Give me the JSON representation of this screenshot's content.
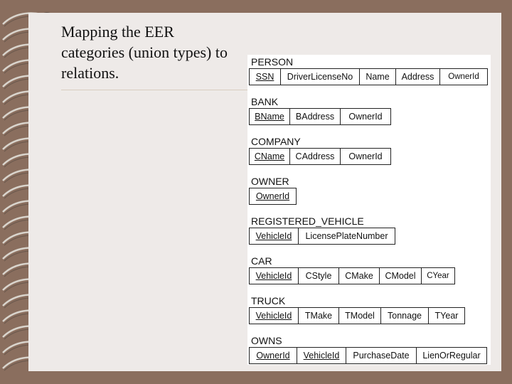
{
  "slide": {
    "title": "Mapping the EER categories (union types) to relations."
  },
  "relations": [
    {
      "name": "PERSON",
      "attributes": [
        "SSN",
        "DriverLicenseNo",
        "Name",
        "Address",
        "OwnerId"
      ],
      "key": [
        0
      ]
    },
    {
      "name": "BANK",
      "attributes": [
        "BName",
        "BAddress",
        "OwnerId"
      ],
      "key": [
        0
      ]
    },
    {
      "name": "COMPANY",
      "attributes": [
        "CName",
        "CAddress",
        "OwnerId"
      ],
      "key": [
        0
      ]
    },
    {
      "name": "OWNER",
      "attributes": [
        "OwnerId"
      ],
      "key": [
        0
      ]
    },
    {
      "name": "REGISTERED_VEHICLE",
      "attributes": [
        "VehicleId",
        "LicensePlateNumber"
      ],
      "key": [
        0
      ]
    },
    {
      "name": "CAR",
      "attributes": [
        "VehicleId",
        "CStyle",
        "CMake",
        "CModel",
        "CYear"
      ],
      "key": [
        0
      ]
    },
    {
      "name": "TRUCK",
      "attributes": [
        "VehicleId",
        "TMake",
        "TModel",
        "Tonnage",
        "TYear"
      ],
      "key": [
        0
      ]
    },
    {
      "name": "OWNS",
      "attributes": [
        "OwnerId",
        "VehicleId",
        "PurchaseDate",
        "LienOrRegular"
      ],
      "key": [
        0,
        1
      ]
    }
  ]
}
